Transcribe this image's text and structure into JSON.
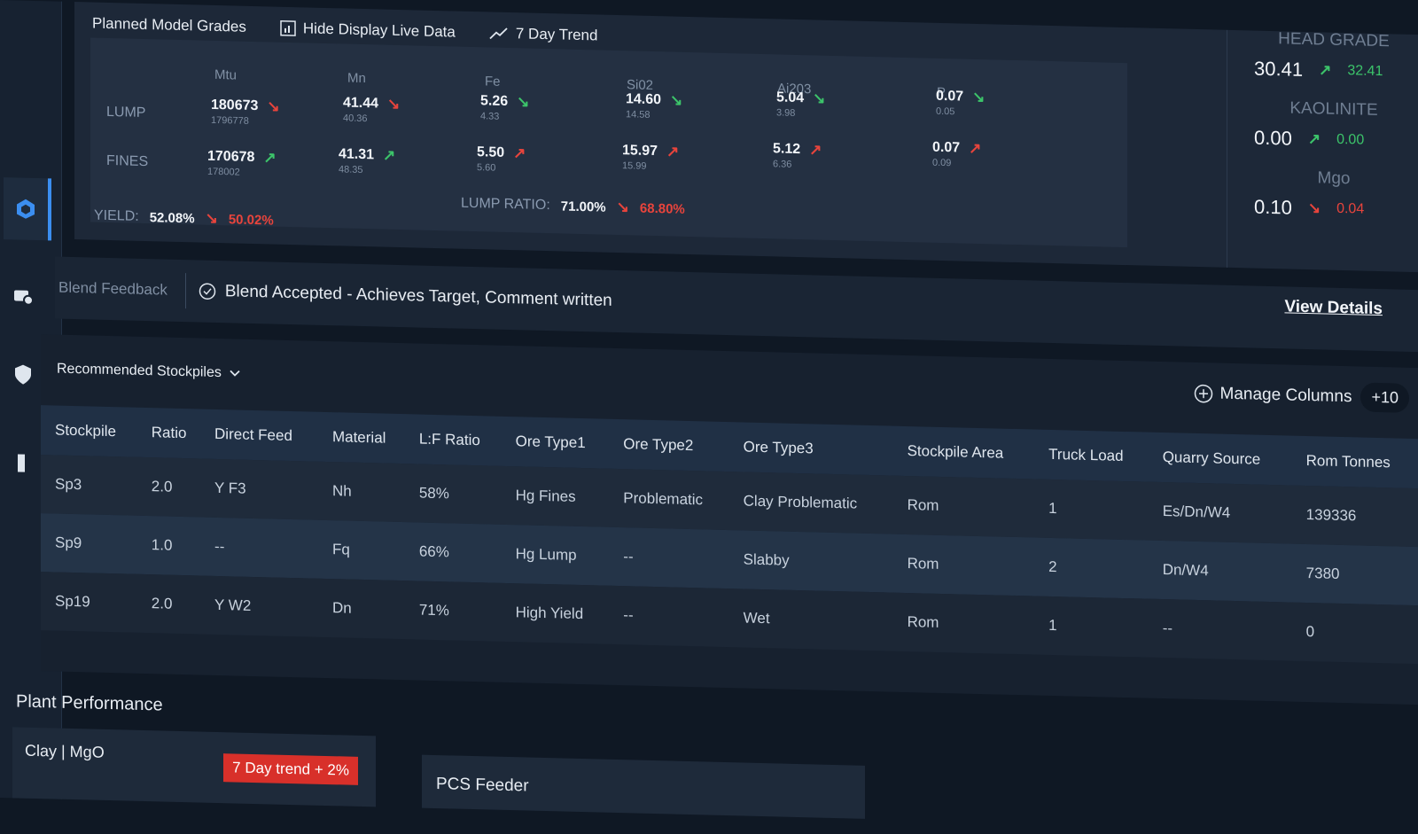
{
  "grades": {
    "title": "Planned Model Grades",
    "hide_live_label": "Hide Display Live Data",
    "trend_label": "7 Day Trend",
    "columns": [
      "Mtu",
      "Mn",
      "Fe",
      "Si02",
      "Ai203",
      "P"
    ],
    "rows": [
      {
        "label": "LUMP",
        "cells": [
          {
            "value": "180673",
            "sub": "1796778"
          },
          {
            "value": "41.44",
            "sub": "40.36"
          },
          {
            "value": "5.26",
            "sub": "4.33"
          },
          {
            "value": "14.60",
            "sub": "14.58"
          },
          {
            "value": "5.04",
            "sub": "3.98"
          },
          {
            "value": "0.07",
            "sub": "0.05"
          }
        ]
      },
      {
        "label": "FINES",
        "cells": [
          {
            "value": "170678",
            "sub": "178002"
          },
          {
            "value": "41.31",
            "sub": "48.35"
          },
          {
            "value": "5.50",
            "sub": "5.60"
          },
          {
            "value": "15.97",
            "sub": "15.99"
          },
          {
            "value": "5.12",
            "sub": "6.36"
          },
          {
            "value": "0.07",
            "sub": "0.09"
          }
        ]
      }
    ],
    "yield": {
      "label": "YIELD:",
      "value": "52.08%",
      "compare": "50.02%"
    },
    "lump_ratio": {
      "label": "LUMP RATIO:",
      "value": "71.00%",
      "compare": "68.80%"
    }
  },
  "head_grades": [
    {
      "title": "HEAD GRADE",
      "value": "30.41",
      "compare": "32.41"
    },
    {
      "title": "KAOLINITE",
      "value": "0.00",
      "compare": "0.00"
    },
    {
      "title": "Mgo",
      "value": "0.10",
      "compare": "0.04"
    }
  ],
  "feedback": {
    "label": "Blend Feedback",
    "status": "Blend Accepted - Achieves  Target, Comment written",
    "view_details": "View Details"
  },
  "stockpiles": {
    "title": "Recommended  Stockpiles",
    "manage_columns": "Manage Columns",
    "extra_columns": "+10",
    "headers": [
      "Stockpile",
      "Ratio",
      "Direct Feed",
      "Material",
      "L:F Ratio",
      "Ore Type1",
      "Ore Type2",
      "Ore Type3",
      "Stockpile Area",
      "Truck Load",
      "Quarry Source",
      "Rom Tonnes"
    ],
    "rows": [
      [
        "Sp3",
        "2.0",
        "Y F3",
        "Nh",
        "58%",
        "Hg Fines",
        "Problematic",
        "Clay Problematic",
        "Rom",
        "1",
        "Es/Dn/W4",
        "139336"
      ],
      [
        "Sp9",
        "1.0",
        "--",
        "Fq",
        "66%",
        "Hg Lump",
        "--",
        "Slabby",
        "Rom",
        "2",
        "Dn/W4",
        "7380"
      ],
      [
        "Sp19",
        "2.0",
        "Y W2",
        "Dn",
        "71%",
        "High Yield",
        "--",
        "Wet",
        "Rom",
        "1",
        "--",
        "0"
      ]
    ]
  },
  "plant": {
    "title": "Plant Performance",
    "card1_title": "Clay  | MgO",
    "card1_badge": "7 Day trend + 2%",
    "card2_title": "PCS Feeder"
  }
}
